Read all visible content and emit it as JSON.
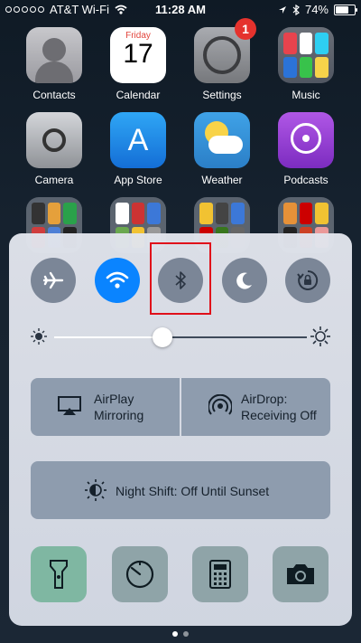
{
  "status_bar": {
    "carrier": "AT&T Wi-Fi",
    "time": "11:28 AM",
    "battery": "74%",
    "battery_level": 0.74
  },
  "home_apps": [
    {
      "label": "Contacts"
    },
    {
      "label": "Calendar",
      "day": "Friday",
      "date": "17"
    },
    {
      "label": "Settings",
      "badge": "1"
    },
    {
      "label": "Music"
    },
    {
      "label": "Camera"
    },
    {
      "label": "App Store"
    },
    {
      "label": "Weather"
    },
    {
      "label": "Podcasts"
    }
  ],
  "control_center": {
    "toggles": [
      {
        "name": "airplane-mode",
        "icon": "airplane-icon",
        "active": false
      },
      {
        "name": "wifi",
        "icon": "wifi-icon",
        "active": true
      },
      {
        "name": "bluetooth",
        "icon": "bluetooth-icon",
        "active": false
      },
      {
        "name": "do-not-disturb",
        "icon": "moon-icon",
        "active": false
      },
      {
        "name": "rotation-lock",
        "icon": "rotation-lock-icon",
        "active": false
      }
    ],
    "brightness": {
      "level": 0.43
    },
    "airplay": {
      "line1": "AirPlay",
      "line2": "Mirroring"
    },
    "airdrop": {
      "line1": "AirDrop:",
      "line2": "Receiving Off"
    },
    "night_shift": {
      "label": "Night Shift: Off Until Sunset"
    },
    "tools": [
      {
        "name": "flashlight",
        "icon": "flashlight-icon"
      },
      {
        "name": "timer",
        "icon": "timer-icon"
      },
      {
        "name": "calculator",
        "icon": "calculator-icon"
      },
      {
        "name": "camera",
        "icon": "camera-icon"
      }
    ]
  },
  "colors": {
    "accent": "#0a84ff",
    "highlight_box": "#e0101a"
  },
  "pages": {
    "count": 2,
    "current": 1
  }
}
